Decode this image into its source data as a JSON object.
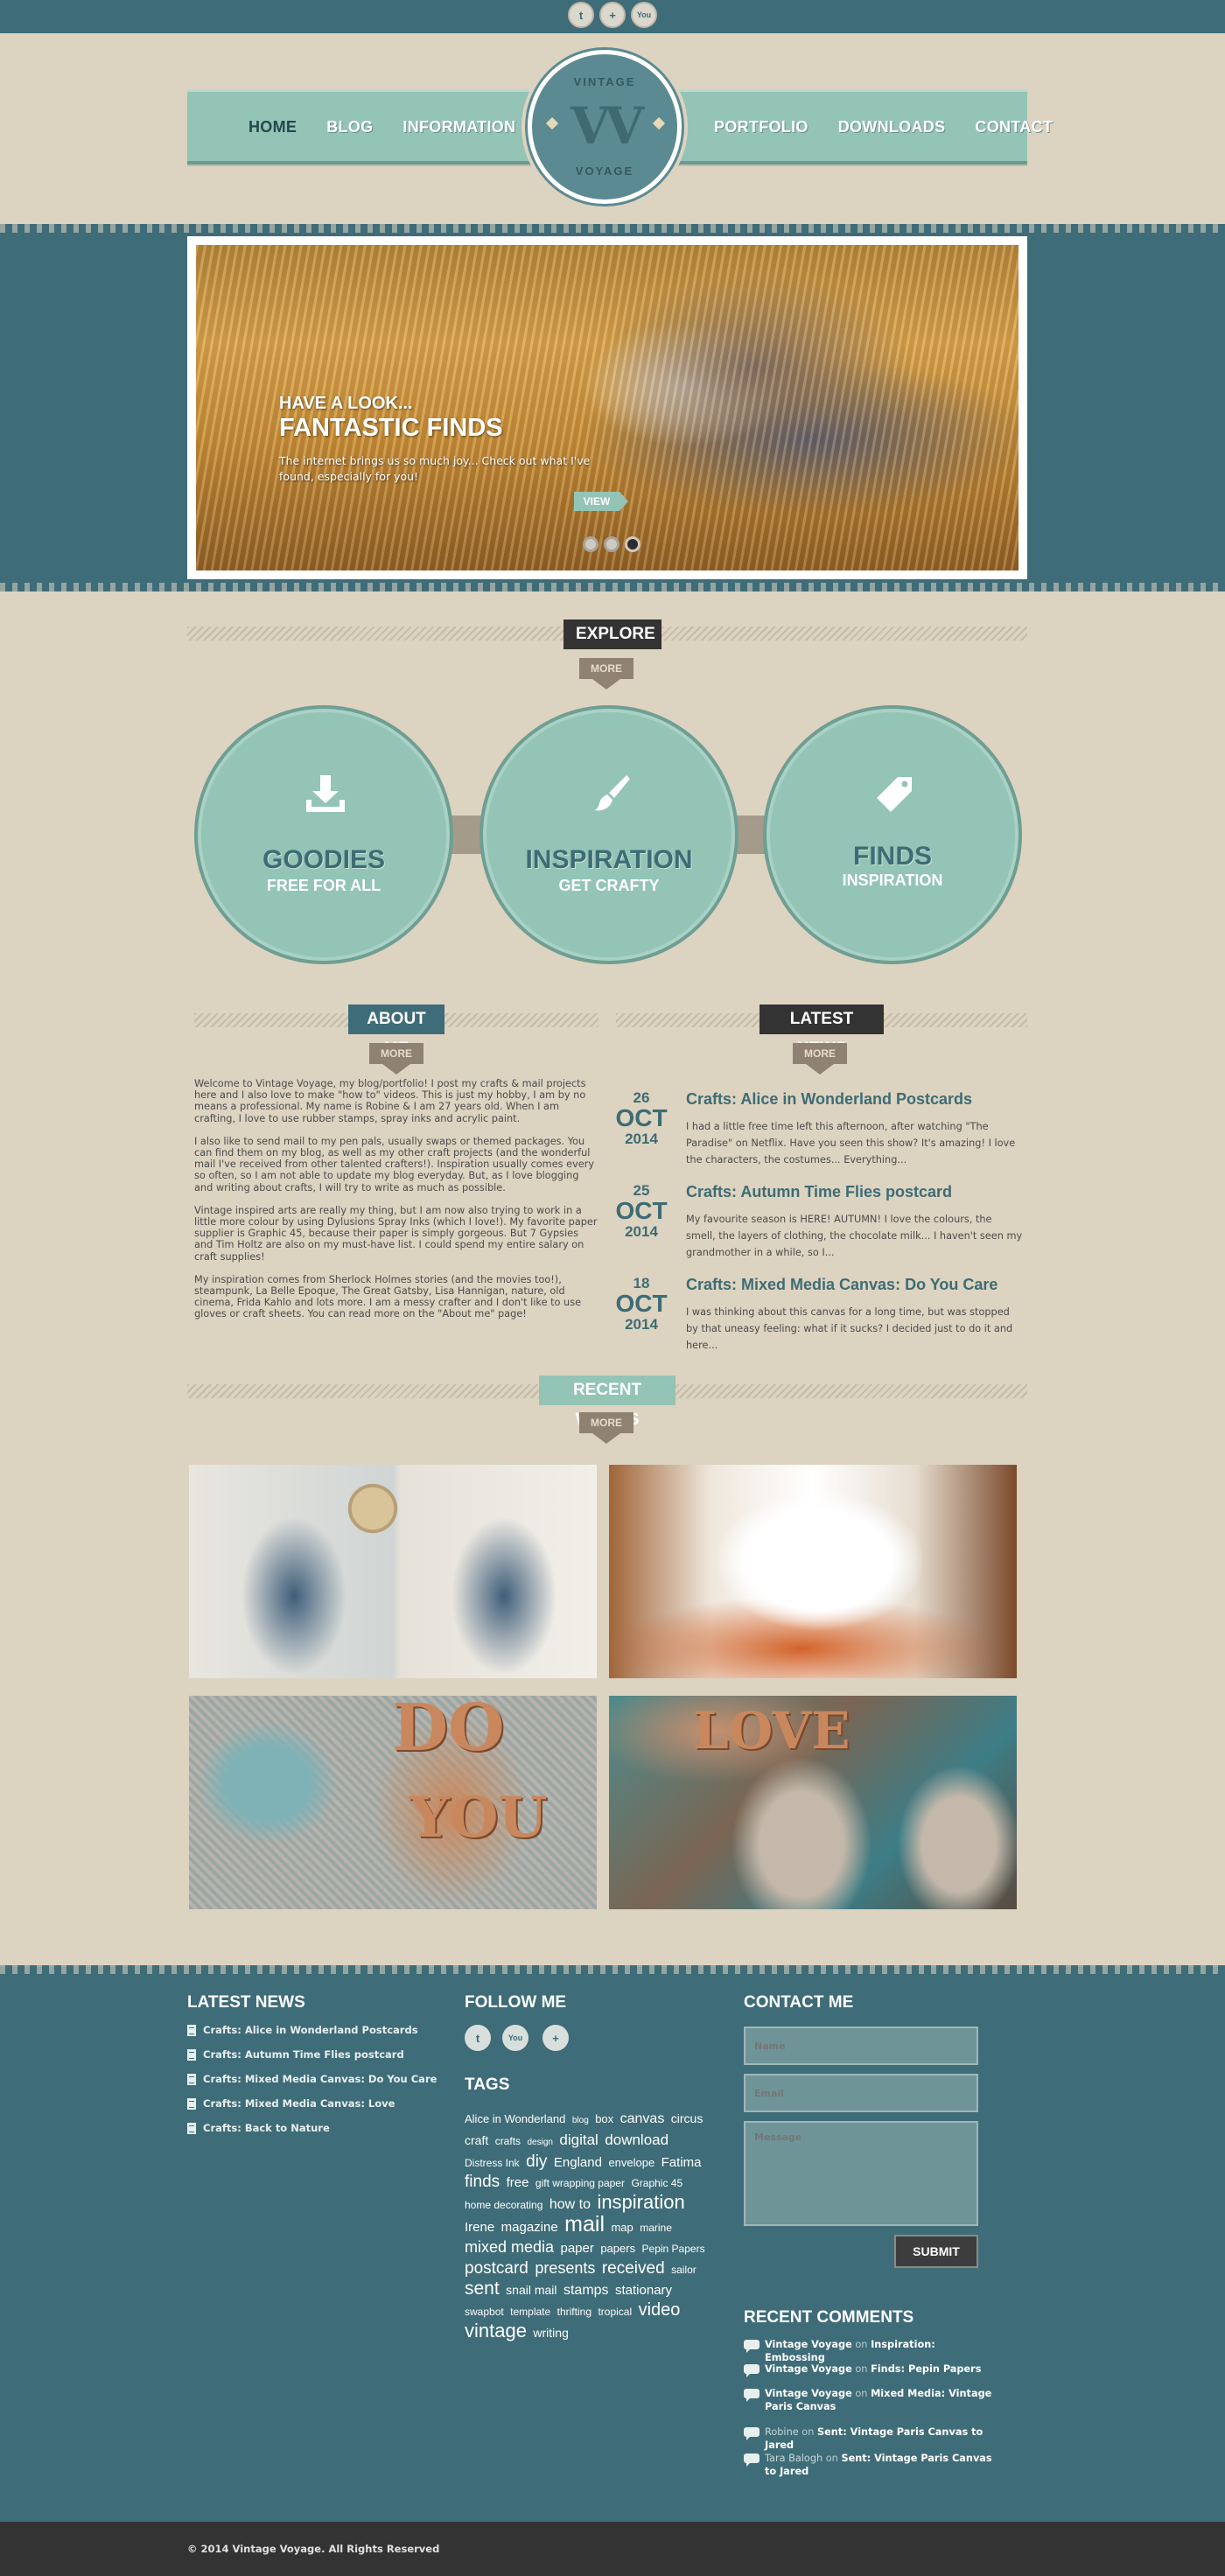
{
  "top_social": [
    {
      "icon": "twitter-icon",
      "glyph": "t"
    },
    {
      "icon": "plus-icon",
      "glyph": "+"
    },
    {
      "icon": "youtube-icon",
      "glyph": "You"
    }
  ],
  "nav": {
    "left": [
      "HOME",
      "BLOG",
      "INFORMATION"
    ],
    "right": [
      "PORTFOLIO",
      "DOWNLOADS",
      "CONTACT"
    ],
    "active": "HOME"
  },
  "logo": {
    "top": "VINTAGE",
    "mark": "VV",
    "bottom": "VOYAGE"
  },
  "slider": {
    "kicker": "HAVE A LOOK...",
    "title": "FANTASTIC FINDS",
    "text": "The internet brings us so much joy... Check out what I've found, especially for you!",
    "button": "VIEW",
    "slides": 3,
    "active_slide": 3
  },
  "explore": {
    "label": "EXPLORE",
    "more": "MORE",
    "circles": [
      {
        "icon": "download-icon",
        "title": "GOODIES",
        "sub": "FREE FOR ALL"
      },
      {
        "icon": "brush-icon",
        "title": "INSPIRATION",
        "sub": "GET CRAFTY"
      },
      {
        "icon": "tag-icon",
        "title": "FINDS",
        "sub": "INSPIRATION"
      }
    ]
  },
  "about": {
    "label": "ABOUT ME",
    "more": "MORE",
    "paragraphs": [
      "Welcome to Vintage Voyage, my blog/portfolio! I post my crafts & mail projects here and I also love to make \"how to\" videos. This is just my hobby, I am by no means a professional. My name is Robine & I am 27 years old. When I am crafting, I love to use rubber stamps, spray inks and acrylic paint.",
      "I also like to send mail to my pen pals, usually swaps or themed packages. You can find them on my blog, as well as my other craft projects (and the wonderful mail I've received from other talented crafters!). Inspiration usually comes every so often, so I am not able to update my blog everyday. But, as I love blogging and writing about crafts, I will try to write as much as possible.",
      "Vintage inspired arts are really my thing, but I am now also trying to work in a little more colour by using Dylusions Spray Inks (which I love!). My favorite paper supplier is Graphic 45, because their paper is simply gorgeous. But 7 Gypsies and Tim Holtz are also on my must-have list. I could spend my entire salary on craft supplies!",
      "My inspiration comes from Sherlock Holmes stories (and the movies too!), steampunk, La Belle Epoque, The Great Gatsby, Lisa Hannigan, nature, old cinema, Frida Kahlo and lots more. I am a messy crafter and I don't like to use gloves or craft sheets. You can read more on the \"About me\" page!"
    ]
  },
  "latest_news": {
    "label": "LATEST NEWS",
    "more": "MORE",
    "items": [
      {
        "day": "26",
        "month": "OCT",
        "year": "2014",
        "title": "Crafts: Alice in Wonderland Postcards",
        "excerpt": "I had a little free time left this afternoon, after watching \"The Paradise\" on Netflix. Have you seen this show? It's amazing! I love the characters, the costumes... Everything..."
      },
      {
        "day": "25",
        "month": "OCT",
        "year": "2014",
        "title": "Crafts: Autumn Time Flies postcard",
        "excerpt": "My favourite season is HERE! AUTUMN! I love the colours, the smell, the layers of clothing, the chocolate milk... I haven't seen my grandmother in a while, so I..."
      },
      {
        "day": "18",
        "month": "OCT",
        "year": "2014",
        "title": "Crafts: Mixed Media Canvas: Do You Care",
        "excerpt": "I was thinking about this canvas for a long time, but was stopped by that uneasy feeling: what if it sucks? I decided just to do it and here..."
      }
    ]
  },
  "recent_works": {
    "label": "RECENT WORKS",
    "more": "MORE",
    "word_do": "DO",
    "word_you": "YOU",
    "word_love": "LOVE"
  },
  "footer": {
    "latest_news": {
      "heading": "LATEST NEWS",
      "items": [
        "Crafts: Alice in Wonderland Postcards",
        "Crafts: Autumn Time Flies postcard",
        "Crafts: Mixed Media Canvas: Do You Care",
        "Crafts: Mixed Media Canvas: Love",
        "Crafts: Back to Nature"
      ]
    },
    "follow": {
      "heading": "FOLLOW ME",
      "icons": [
        {
          "icon": "twitter-icon",
          "glyph": "t"
        },
        {
          "icon": "youtube-icon",
          "glyph": "You"
        },
        {
          "icon": "plus-icon",
          "glyph": "+"
        }
      ]
    },
    "tags": {
      "heading": "TAGS",
      "items": [
        {
          "t": "Alice in Wonderland",
          "s": 13
        },
        {
          "t": "blog",
          "s": 10
        },
        {
          "t": "box",
          "s": 13
        },
        {
          "t": "canvas",
          "s": 16
        },
        {
          "t": "circus",
          "s": 14
        },
        {
          "t": "craft",
          "s": 14
        },
        {
          "t": "crafts",
          "s": 12
        },
        {
          "t": "design",
          "s": 10
        },
        {
          "t": "digital",
          "s": 17
        },
        {
          "t": "download",
          "s": 17
        },
        {
          "t": "Distress Ink",
          "s": 12
        },
        {
          "t": "diy",
          "s": 19
        },
        {
          "t": "England",
          "s": 15
        },
        {
          "t": "envelope",
          "s": 13
        },
        {
          "t": "Fatima",
          "s": 15
        },
        {
          "t": "finds",
          "s": 19
        },
        {
          "t": "free",
          "s": 15
        },
        {
          "t": "gift wrapping paper",
          "s": 12
        },
        {
          "t": "Graphic 45",
          "s": 12
        },
        {
          "t": "home decorating",
          "s": 12
        },
        {
          "t": "how to",
          "s": 16
        },
        {
          "t": "inspiration",
          "s": 22
        },
        {
          "t": "Irene",
          "s": 15
        },
        {
          "t": "magazine",
          "s": 15
        },
        {
          "t": "mail",
          "s": 25
        },
        {
          "t": "map",
          "s": 13
        },
        {
          "t": "marine",
          "s": 12
        },
        {
          "t": "mixed media",
          "s": 18
        },
        {
          "t": "paper",
          "s": 15
        },
        {
          "t": "papers",
          "s": 13
        },
        {
          "t": "Pepin Papers",
          "s": 12
        },
        {
          "t": "postcard",
          "s": 19
        },
        {
          "t": "presents",
          "s": 18
        },
        {
          "t": "received",
          "s": 19
        },
        {
          "t": "sailor",
          "s": 12
        },
        {
          "t": "sent",
          "s": 21
        },
        {
          "t": "snail mail",
          "s": 14
        },
        {
          "t": "stamps",
          "s": 16
        },
        {
          "t": "stationary",
          "s": 15
        },
        {
          "t": "swapbot",
          "s": 12
        },
        {
          "t": "template",
          "s": 12
        },
        {
          "t": "thrifting",
          "s": 12
        },
        {
          "t": "tropical",
          "s": 12
        },
        {
          "t": "video",
          "s": 20
        },
        {
          "t": "vintage",
          "s": 22
        },
        {
          "t": "writing",
          "s": 14
        }
      ]
    },
    "contact": {
      "heading": "CONTACT ME",
      "name_placeholder": "Name",
      "email_placeholder": "Email",
      "message_placeholder": "Message",
      "submit": "SUBMIT"
    },
    "recent_comments": {
      "heading": "RECENT COMMENTS",
      "items": [
        {
          "author": "Vintage Voyage",
          "on": "on",
          "post": "Inspiration: Embossing",
          "author_linked": true
        },
        {
          "author": "Vintage Voyage",
          "on": "on",
          "post": "Finds: Pepin Papers",
          "author_linked": true
        },
        {
          "author": "Vintage Voyage",
          "on": "on",
          "post": "Mixed Media: Vintage Paris Canvas",
          "author_linked": true
        },
        {
          "author": "Robine",
          "on": "on",
          "post": "Sent: Vintage Paris Canvas to Jared",
          "author_linked": false
        },
        {
          "author": "Tara Balogh",
          "on": "on",
          "post": "Sent: Vintage Paris Canvas to Jared",
          "author_linked": false
        }
      ]
    }
  },
  "copyright": "© 2014 Vintage Voyage. All Rights Reserved",
  "colors": {
    "teal_dark": "#3e6c78",
    "mint": "#93c4b6",
    "beige": "#ddd3c1",
    "charcoal": "#333333",
    "mocha": "#8f8272"
  }
}
